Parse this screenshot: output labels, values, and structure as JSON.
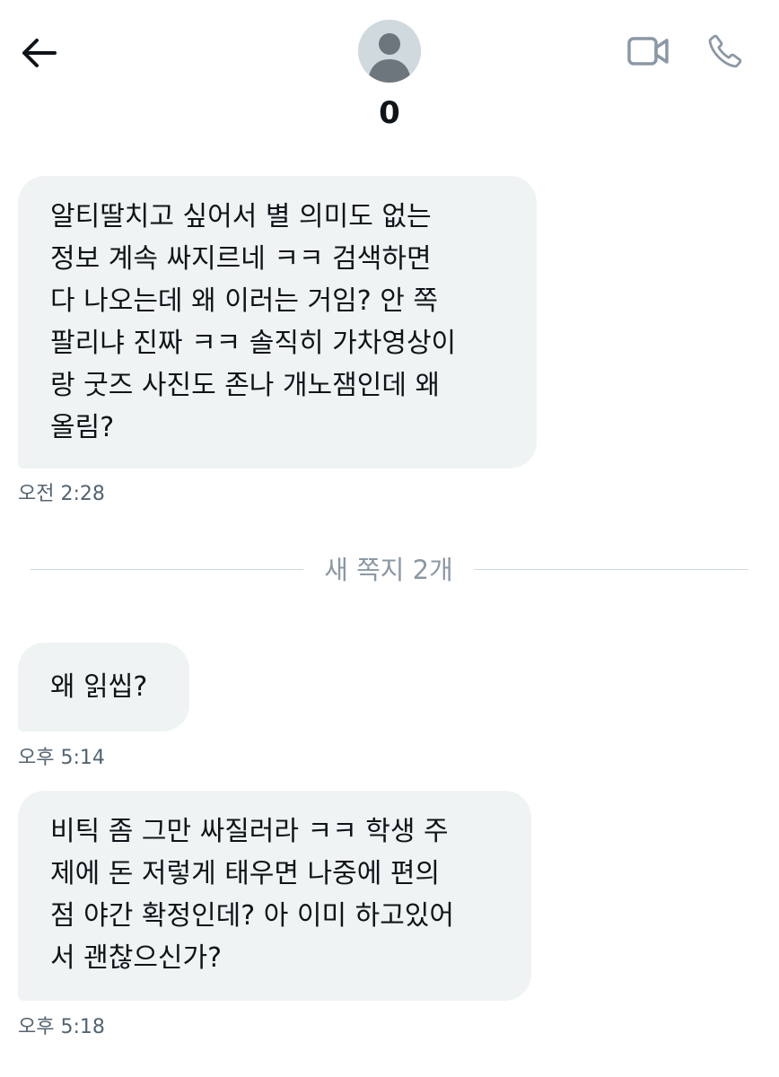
{
  "header": {
    "contact_name": "0",
    "icons": {
      "back": "arrow-left-icon",
      "avatar": "default-avatar-icon",
      "video": "video-camera-icon",
      "call": "phone-icon"
    }
  },
  "messages": [
    {
      "text": "알티딸치고 싶어서 별 의미도 없는\n정보 계속 싸지르네 ㅋㅋ 검색하면\n다 나오는데 왜 이러는 거임? 안 쪽\n팔리냐 진짜 ㅋㅋ 솔직히 가차영상이\n랑 굿즈 사진도 존나 개노잼인데 왜\n올림?",
      "time": "오전 2:28"
    },
    {
      "text": "왜 읽씹?",
      "time": "오후 5:14"
    },
    {
      "text": "비틱 좀 그만 싸질러라 ㅋㅋ 학생 주\n제에 돈 저렇게 태우면 나중에 편의\n점 야간 확정인데? 아 이미 하고있어\n서 괜찮으신가?",
      "time": "오후 5:18"
    }
  ],
  "divider": {
    "label": "새 쪽지 2개"
  },
  "colors": {
    "bubble_bg": "#eff3f4",
    "text": "#0f1419",
    "muted": "#536471",
    "divider_text": "#8b98a5",
    "icon_gray": "#8b98a5"
  }
}
